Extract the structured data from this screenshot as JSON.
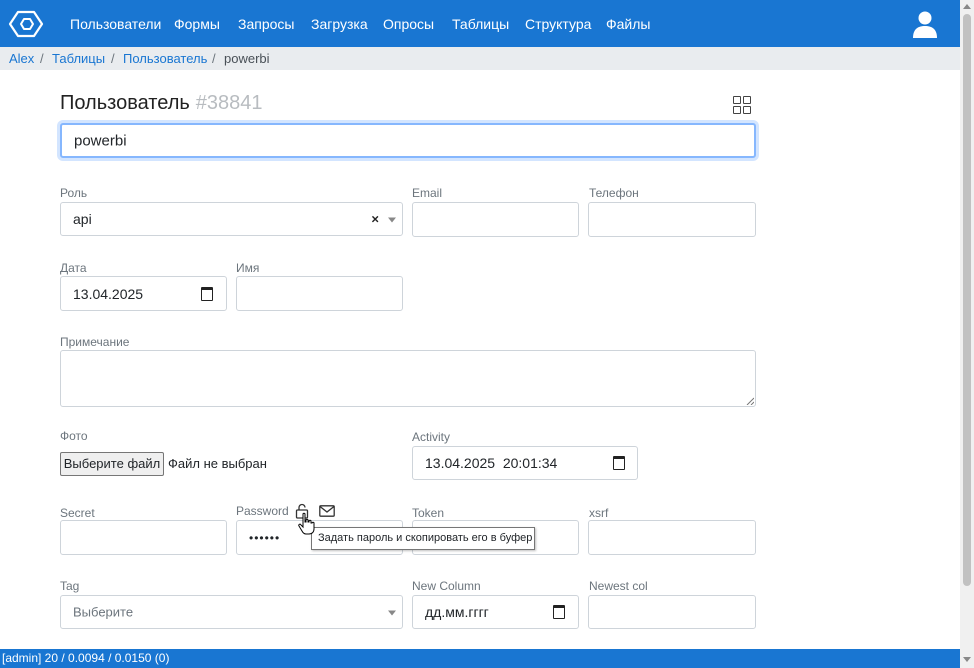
{
  "nav": {
    "items": [
      "Пользователи",
      "Формы",
      "Запросы",
      "Загрузка",
      "Опросы",
      "Таблицы",
      "Структура",
      "Файлы"
    ]
  },
  "breadcrumb": {
    "items": [
      "Alex",
      "Таблицы",
      "Пользователь",
      "powerbi"
    ],
    "separator": "/"
  },
  "form": {
    "title": "Пользователь",
    "record_id": "#38841",
    "main_value": "powerbi",
    "role": {
      "label": "Роль",
      "value": "api",
      "clear": "×"
    },
    "email": {
      "label": "Email",
      "value": ""
    },
    "phone": {
      "label": "Телефон",
      "value": ""
    },
    "date": {
      "label": "Дата",
      "value": "13.04.2025"
    },
    "name": {
      "label": "Имя",
      "value": ""
    },
    "note": {
      "label": "Примечание",
      "value": ""
    },
    "photo": {
      "label": "Фото",
      "button": "Выберите файл",
      "status": "Файл не выбран"
    },
    "activity": {
      "label": "Activity",
      "value": "13.04.2025  20:01:34"
    },
    "secret": {
      "label": "Secret",
      "value": ""
    },
    "password": {
      "label": "Password",
      "value": "••••••",
      "tooltip": "Задать пароль и скопировать его в буфер"
    },
    "token": {
      "label": "Token",
      "value": ""
    },
    "xsrf": {
      "label": "xsrf",
      "value": ""
    },
    "tag": {
      "label": "Tag",
      "placeholder": "Выберите"
    },
    "new_column": {
      "label": "New Column",
      "placeholder": "дд.мм.гггг"
    },
    "newest_col": {
      "label": "Newest col",
      "value": ""
    }
  },
  "status": {
    "text": "[admin] 20 / 0.0094 / 0.0150 (0)"
  },
  "colors": {
    "primary": "#1976d2",
    "breadcrumb_bg": "#e9ecef",
    "focus_border": "#86b7fe"
  },
  "icons": [
    "logo-icon",
    "user-icon",
    "grid-icon",
    "calendar-icon",
    "lock-icon",
    "mail-icon"
  ]
}
